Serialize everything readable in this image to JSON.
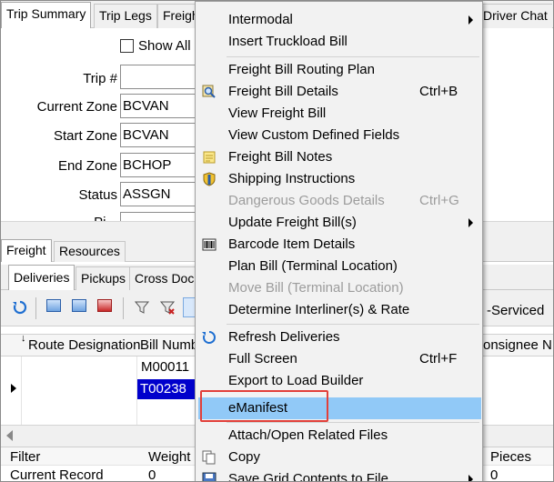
{
  "top_tabs": [
    "Trip Summary",
    "Trip Legs",
    "Freigh",
    "Driver Chat"
  ],
  "form": {
    "show_all_label": "Show All",
    "fields": [
      {
        "label": "Trip #",
        "value": ""
      },
      {
        "label": "Current Zone",
        "value": "BCVAN"
      },
      {
        "label": "Start Zone",
        "value": "BCVAN"
      },
      {
        "label": "End Zone",
        "value": "BCHOP"
      },
      {
        "label": "Status",
        "value": "ASSGN"
      },
      {
        "label": "Pi...",
        "value": ""
      }
    ]
  },
  "freight_tabs": [
    "Freight",
    "Resources"
  ],
  "sub_tabs": [
    "Deliveries",
    "Pickups",
    "Cross Doc"
  ],
  "toolbar_right_text": "-Serviced",
  "grid": {
    "columns": [
      "Route Designation",
      "Bill Numb",
      "onsignee N"
    ],
    "rows": [
      {
        "bill": "M00011",
        "selected": false
      },
      {
        "bill": "T00238",
        "selected": true
      }
    ]
  },
  "footer": {
    "headers": [
      "Filter",
      "Weight",
      "Pieces"
    ],
    "current_record": {
      "label": "Current Record",
      "weight": "0",
      "pieces": "0"
    }
  },
  "menu": {
    "items": [
      {
        "label": "Intermodal",
        "shortcut": "",
        "submenu": true,
        "disabled": false,
        "icon": ""
      },
      {
        "label": "Insert Truckload Bill",
        "shortcut": "",
        "submenu": false,
        "disabled": false,
        "icon": ""
      },
      {
        "label": "Freight Bill Routing Plan",
        "shortcut": "",
        "submenu": false,
        "disabled": false,
        "icon": ""
      },
      {
        "label": "Freight Bill Details",
        "shortcut": "Ctrl+B",
        "submenu": false,
        "disabled": false,
        "icon": "magnifier-icon"
      },
      {
        "label": "View Freight Bill",
        "shortcut": "",
        "submenu": false,
        "disabled": false,
        "icon": ""
      },
      {
        "label": "View Custom Defined Fields",
        "shortcut": "",
        "submenu": false,
        "disabled": false,
        "icon": ""
      },
      {
        "label": "Freight Bill Notes",
        "shortcut": "",
        "submenu": false,
        "disabled": false,
        "icon": "notes-icon"
      },
      {
        "label": "Shipping Instructions",
        "shortcut": "",
        "submenu": false,
        "disabled": false,
        "icon": "shield-icon"
      },
      {
        "label": "Dangerous Goods Details",
        "shortcut": "Ctrl+G",
        "submenu": false,
        "disabled": true,
        "icon": ""
      },
      {
        "label": "Update Freight Bill(s)",
        "shortcut": "",
        "submenu": true,
        "disabled": false,
        "icon": ""
      },
      {
        "label": "Barcode Item Details",
        "shortcut": "",
        "submenu": false,
        "disabled": false,
        "icon": "barcode-icon"
      },
      {
        "label": "Plan Bill (Terminal Location)",
        "shortcut": "",
        "submenu": false,
        "disabled": false,
        "icon": ""
      },
      {
        "label": "Move Bill (Terminal Location)",
        "shortcut": "",
        "submenu": false,
        "disabled": true,
        "icon": ""
      },
      {
        "label": "Determine Interliner(s) & Rate",
        "shortcut": "",
        "submenu": false,
        "disabled": false,
        "icon": ""
      },
      {
        "label": "Refresh Deliveries",
        "shortcut": "",
        "submenu": false,
        "disabled": false,
        "icon": "refresh-icon"
      },
      {
        "label": "Full Screen",
        "shortcut": "Ctrl+F",
        "submenu": false,
        "disabled": false,
        "icon": ""
      },
      {
        "label": "Export to Load Builder",
        "shortcut": "",
        "submenu": false,
        "disabled": false,
        "icon": ""
      },
      {
        "label": "eManifest",
        "shortcut": "",
        "submenu": false,
        "disabled": false,
        "icon": ""
      },
      {
        "label": "Attach/Open Related Files",
        "shortcut": "",
        "submenu": false,
        "disabled": false,
        "icon": ""
      },
      {
        "label": "Copy",
        "shortcut": "",
        "submenu": false,
        "disabled": false,
        "icon": "copy-icon"
      },
      {
        "label": "Save Grid Contents to File",
        "shortcut": "",
        "submenu": true,
        "disabled": false,
        "icon": "save-icon"
      }
    ],
    "highlighted_item": "eManifest"
  },
  "colors": {
    "menu_highlight": "#91c9f7",
    "callout_border": "#e2403a",
    "grid_selection": "#0000cc",
    "chrome": "#f0f0f0"
  }
}
